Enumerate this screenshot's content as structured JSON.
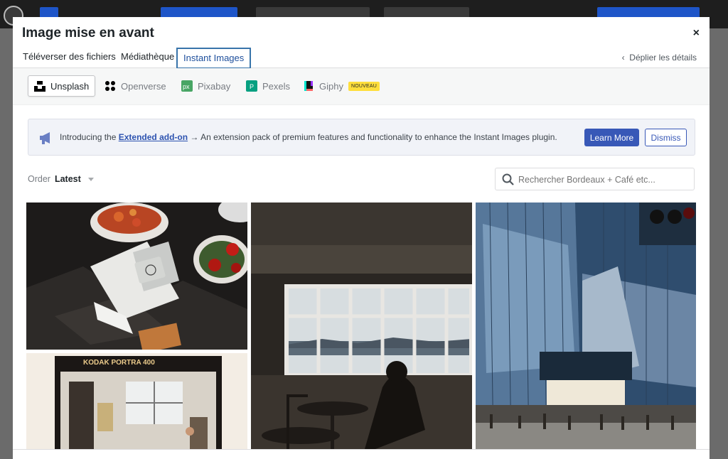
{
  "modal": {
    "title": "Image mise en avant",
    "close_label": "×"
  },
  "router": {
    "tabs": [
      {
        "label": "Téléverser des fichiers"
      },
      {
        "label": "Médiathèque"
      },
      {
        "label": "Instant Images",
        "active": true
      }
    ],
    "toggle_details": "Déplier les détails"
  },
  "providers": [
    {
      "label": "Unsplash",
      "icon": "unsplash-icon",
      "active": true
    },
    {
      "label": "Openverse",
      "icon": "openverse-icon"
    },
    {
      "label": "Pixabay",
      "icon": "pixabay-icon"
    },
    {
      "label": "Pexels",
      "icon": "pexels-icon"
    },
    {
      "label": "Giphy",
      "icon": "giphy-icon",
      "badge": "NOUVEAU"
    }
  ],
  "notice": {
    "text_before": "Introducing the ",
    "link": "Extended add-on",
    "text_after": " → An extension pack of premium features and functionality to enhance the Instant Images plugin.",
    "learn_more": "Learn More",
    "dismiss": "Dismiss"
  },
  "toolbar": {
    "order_label": "Order",
    "order_value": "Latest",
    "search_placeholder": "Rechercher Bordeaux + Café etc..."
  },
  "photos": [
    {
      "name": "photo-payment-terminal",
      "film_label": "KODAK PORTRA 400"
    },
    {
      "name": "photo-film-studio"
    },
    {
      "name": "photo-window-room"
    },
    {
      "name": "photo-glass-building"
    }
  ],
  "colors": {
    "accent": "#3858b7",
    "tab_border": "#3874aa",
    "badge": "#ffde3b"
  }
}
